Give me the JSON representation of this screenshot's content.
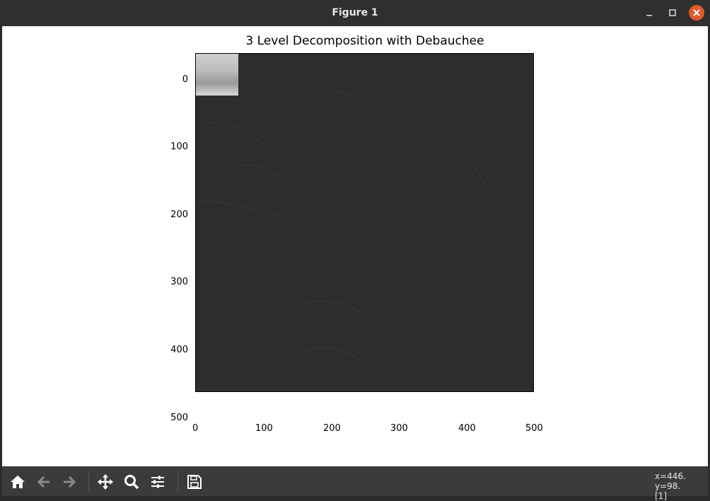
{
  "window": {
    "title": "Figure 1"
  },
  "plot": {
    "title": "3 Level Decomposition with Debauchee",
    "x_ticks": [
      "0",
      "100",
      "200",
      "300",
      "400",
      "500"
    ],
    "y_ticks": [
      "0",
      "100",
      "200",
      "300",
      "400",
      "500"
    ]
  },
  "status": {
    "coords": "x=446. y=98.",
    "value": "[1]"
  },
  "colors": {
    "axes_bg": "#2d2d2d",
    "toolbar": "#3b3b3b",
    "close": "#e05a2b"
  },
  "toolbar": {
    "icons": [
      "home-icon",
      "back-arrow-icon",
      "forward-arrow-icon",
      "pan-icon",
      "zoom-icon",
      "subplots-config-icon",
      "save-icon"
    ]
  }
}
